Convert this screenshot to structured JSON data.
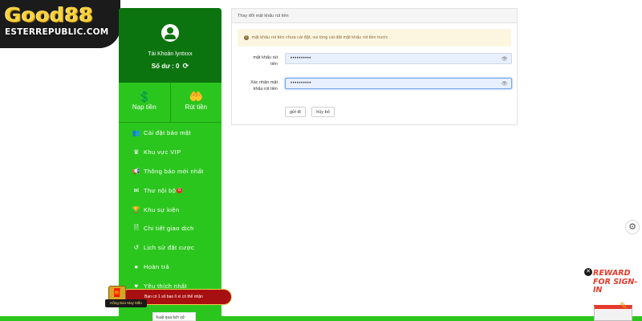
{
  "logo": {
    "title": "Good88",
    "subtitle": "ESTERREPUBLIC.COM"
  },
  "account": {
    "name": "Tài Khoản lyntxxx",
    "balance_label": "Số dư : 0",
    "refresh_icon": "refresh-icon"
  },
  "actions": [
    {
      "label": "Nạp tiền",
      "icon": "deposit-icon"
    },
    {
      "label": "Rút tiền",
      "icon": "withdraw-icon"
    }
  ],
  "menu": [
    {
      "label": "Cài đặt bảo mật",
      "icon": "user-shield-icon",
      "glyph": "👥"
    },
    {
      "label": "Khu vực VIP",
      "icon": "crown-icon",
      "glyph": "♛"
    },
    {
      "label": "Thông báo mới nhất",
      "icon": "megaphone-icon",
      "glyph": "📢"
    },
    {
      "label": "Thư nội bộ",
      "icon": "mail-icon",
      "glyph": "✉",
      "badge": "0"
    },
    {
      "label": "Khu sự kiện",
      "icon": "trophy-icon",
      "glyph": "🏆"
    },
    {
      "label": "Chi tiết giao dịch",
      "icon": "document-icon",
      "glyph": "🗎"
    },
    {
      "label": "Lịch sử đặt cược",
      "icon": "history-icon",
      "glyph": "↺"
    },
    {
      "label": "Hoàn trả",
      "icon": "rebate-icon",
      "glyph": "●"
    },
    {
      "label": "Yêu thích nhất",
      "icon": "heart-icon",
      "glyph": "♥"
    }
  ],
  "panel": {
    "header": "Thay đổi mật khẩu rút tiền",
    "notice": "mật khẩu rút tiền chưa cài đặt, vui lòng cài đặt mật khẩu rút tiền trước",
    "fields": [
      {
        "label_line1": "mật khẩu rút",
        "label_line2": "tiền",
        "value": "••••••••••"
      },
      {
        "label_line1": "Xác nhận mật",
        "label_line2": "khẩu rút tiền",
        "value": "••••••••••"
      }
    ],
    "submit_label": "gửi đi",
    "cancel_label": "hủy bỏ"
  },
  "promo": {
    "gift_label": "Hồng Bao May Mắn",
    "banner_text": "Bạn có 1 số bao lì xì có thể nhận"
  },
  "history_tab": "Xuất qua lịch sử",
  "reward": {
    "text": "REWARD FOR SIGN-IN"
  },
  "colors": {
    "sidebar_green": "#2bc61d",
    "account_green": "#0c740f",
    "notice_bg": "#fcf6e1",
    "input_bg": "#e8f0fe",
    "reward_red": "#e43a2a"
  }
}
